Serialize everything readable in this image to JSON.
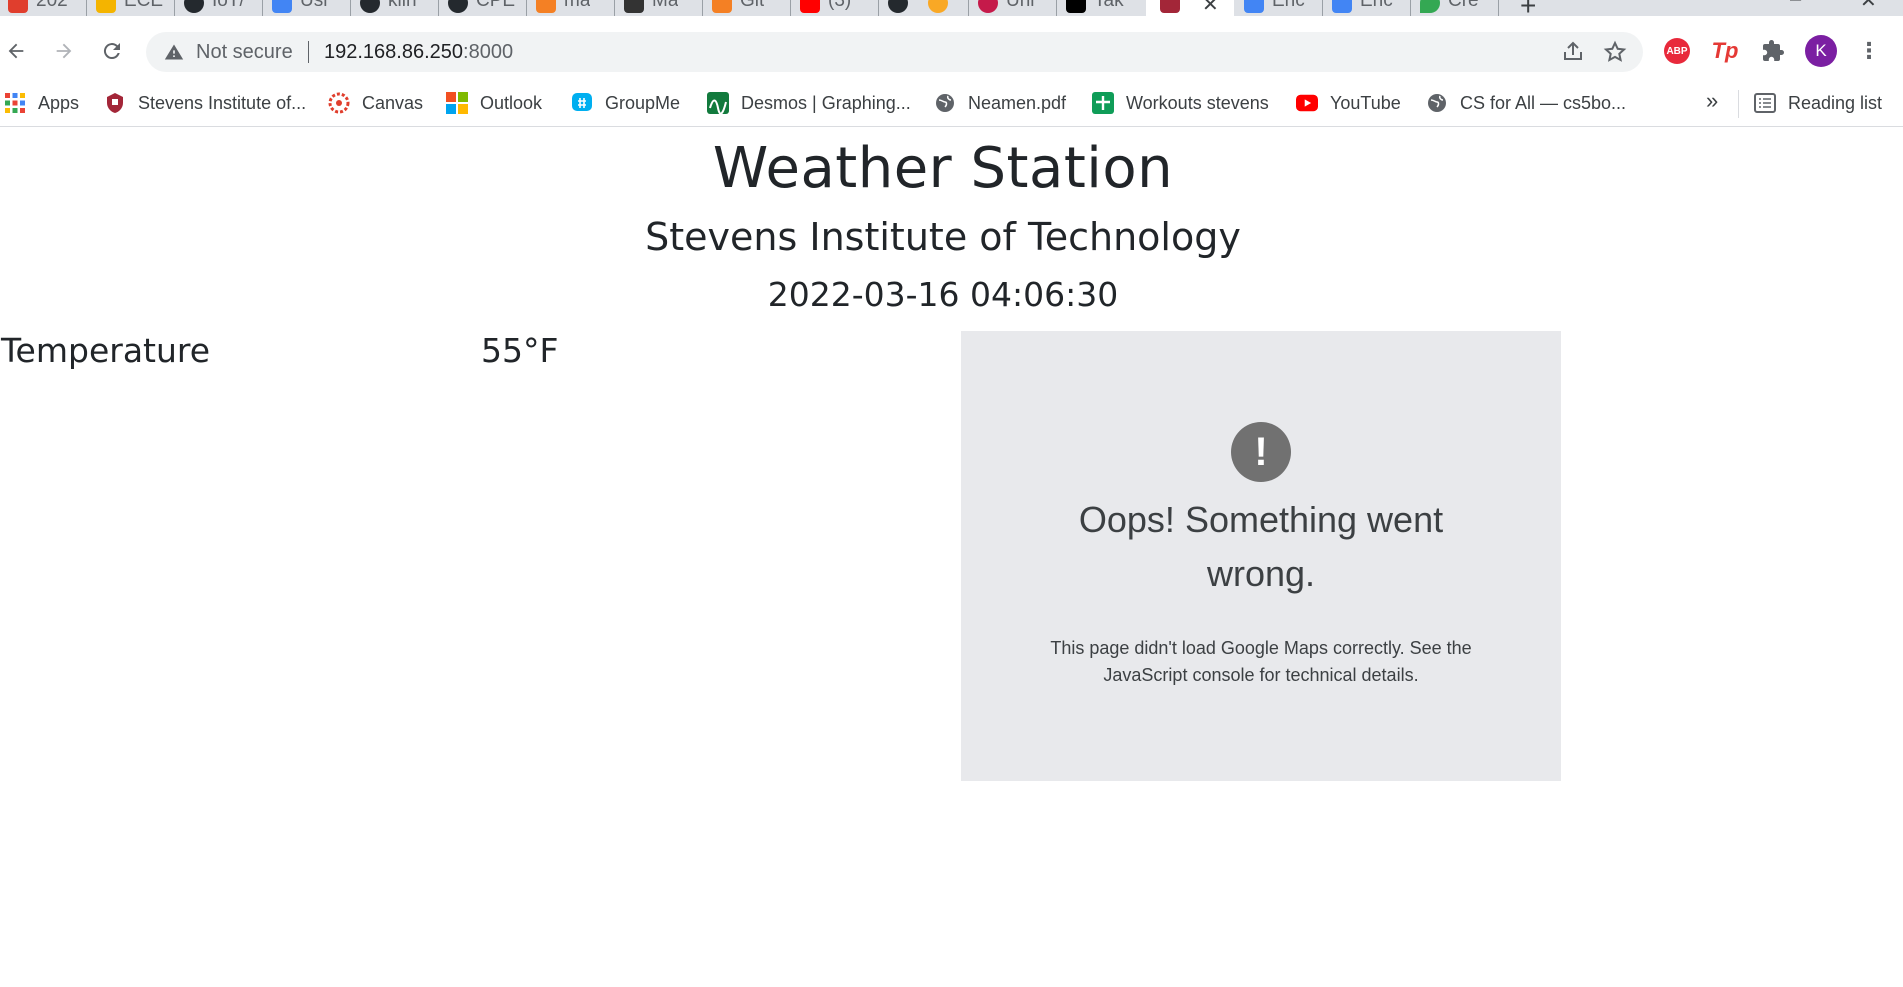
{
  "browser": {
    "tabs": [
      {
        "title": "202",
        "icon": "canvas-icon",
        "color": "#e03e2d"
      },
      {
        "title": "ECE",
        "icon": "slides-icon",
        "color": "#f4b400"
      },
      {
        "title": "IoT/",
        "icon": "github-icon",
        "color": "#24292e"
      },
      {
        "title": "Usi",
        "icon": "google-cloud-icon",
        "color": "#4285f4"
      },
      {
        "title": "kiin",
        "icon": "github-icon",
        "color": "#24292e"
      },
      {
        "title": "CPE",
        "icon": "github-icon",
        "color": "#24292e"
      },
      {
        "title": "ma",
        "icon": "stackoverflow-icon",
        "color": "#f48024"
      },
      {
        "title": "Ma",
        "icon": "mail-icon",
        "color": "#333333"
      },
      {
        "title": "Git",
        "icon": "stackoverflow-icon",
        "color": "#f48024"
      },
      {
        "title": "(3)",
        "icon": "youtube-icon",
        "color": "#ff0000"
      },
      {
        "title": "",
        "icon": "accessibility-icon",
        "color": "#24292e"
      },
      {
        "title": "",
        "icon": "emoji-icon",
        "color": "#f9a825"
      },
      {
        "title": "Uni",
        "icon": "raspberry-icon",
        "color": "#c51a4a"
      },
      {
        "title": "Tak",
        "icon": "medium-icon",
        "color": "#000000"
      },
      {
        "title": "",
        "icon": "stevens-icon",
        "color": "#a32638",
        "active": true
      },
      {
        "title": "Enc",
        "icon": "google-cloud-icon",
        "color": "#4285f4"
      },
      {
        "title": "Enc",
        "icon": "google-cloud-icon",
        "color": "#4285f4"
      },
      {
        "title": "Cre",
        "icon": "maps-pin-icon",
        "color": "#34a853"
      }
    ],
    "omnibox": {
      "security_label": "Not secure",
      "host": "192.168.86.250",
      "port": ":8000"
    },
    "profile_initial": "K",
    "abp_label": "ABP",
    "tp_label": "Tp",
    "bookmarks": [
      {
        "label": "Apps",
        "icon": "apps-grid-icon"
      },
      {
        "label": "Stevens Institute of...",
        "icon": "stevens-icon"
      },
      {
        "label": "Canvas",
        "icon": "canvas-icon"
      },
      {
        "label": "Outlook",
        "icon": "microsoft-icon"
      },
      {
        "label": "GroupMe",
        "icon": "groupme-icon"
      },
      {
        "label": "Desmos | Graphing...",
        "icon": "desmos-icon"
      },
      {
        "label": "Neamen.pdf",
        "icon": "globe-icon"
      },
      {
        "label": "Workouts stevens",
        "icon": "sheets-icon"
      },
      {
        "label": "YouTube",
        "icon": "youtube-icon"
      },
      {
        "label": "CS for All — cs5bo...",
        "icon": "globe-icon"
      }
    ],
    "more_bookmarks": "»",
    "reading_list": "Reading list"
  },
  "page": {
    "title": "Weather Station",
    "subtitle": "Stevens Institute of Technology",
    "timestamp": "2022-03-16 04:06:30",
    "reading": {
      "label": "Temperature",
      "value": "55°F"
    },
    "map_error": {
      "icon_glyph": "!",
      "title": "Oops! Something went wrong.",
      "detail": "This page didn't load Google Maps correctly. See the JavaScript console for technical details."
    }
  }
}
